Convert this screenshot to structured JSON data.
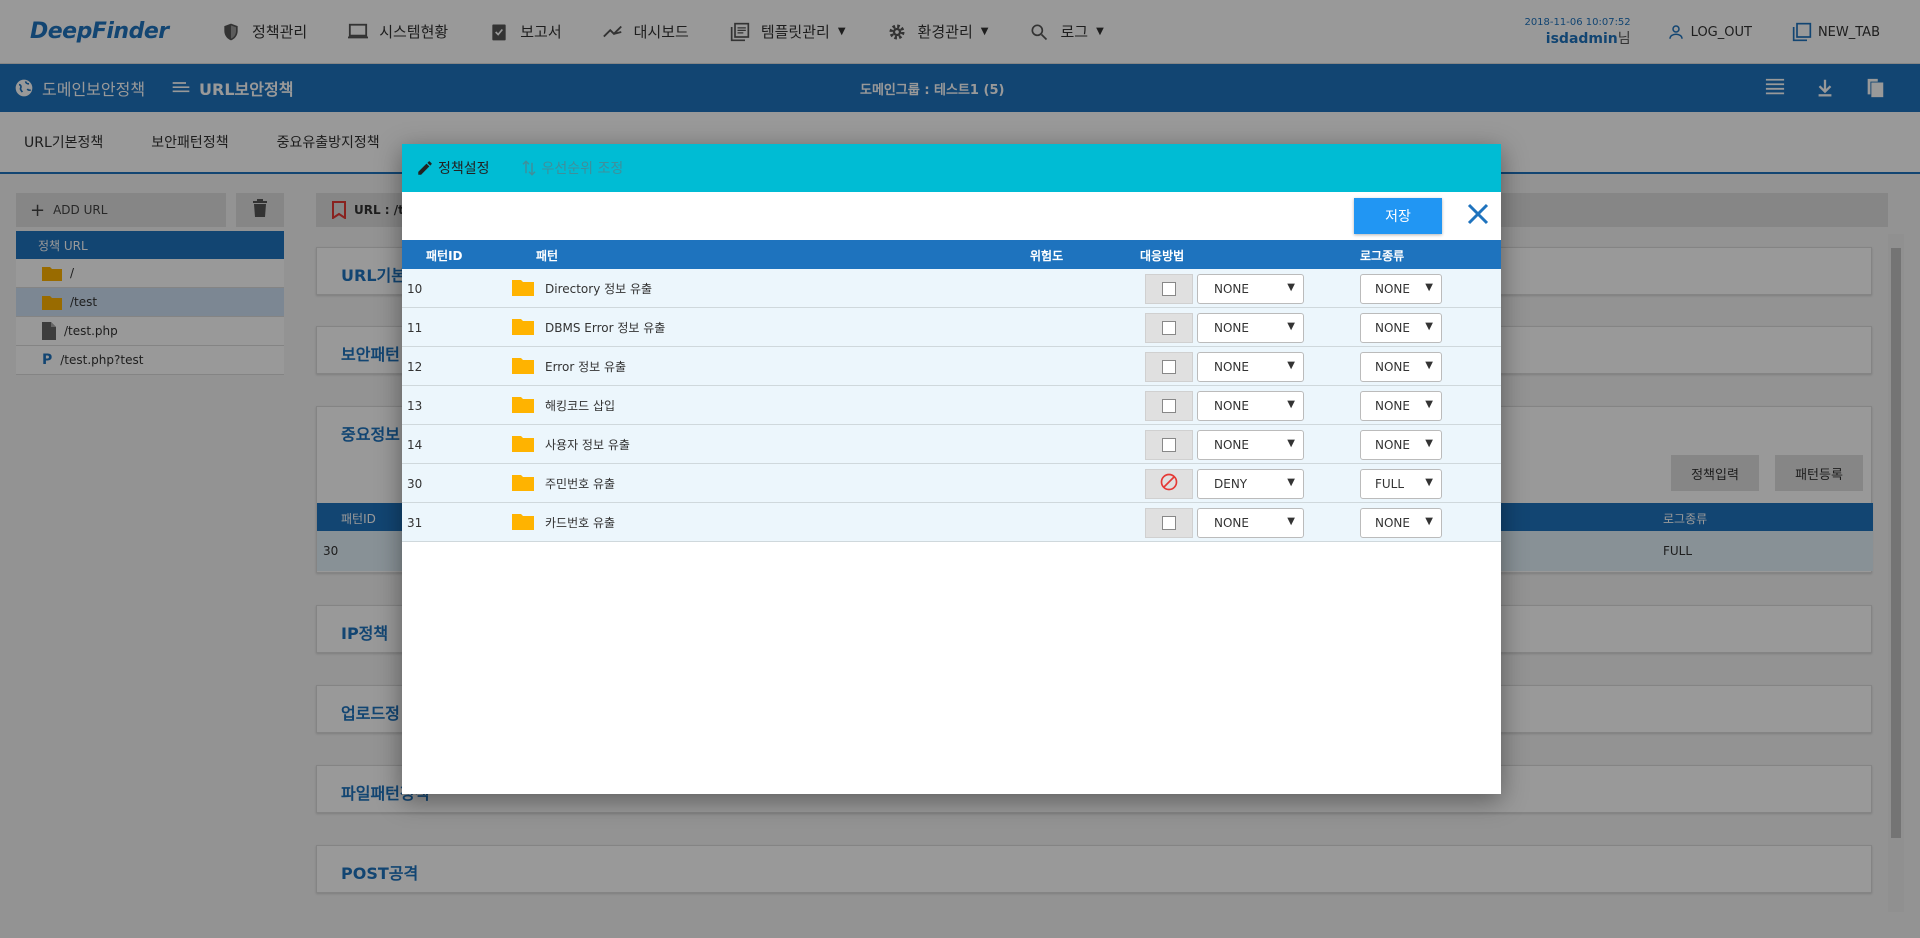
{
  "app": {
    "logo": "DeepFinder"
  },
  "nav": {
    "items": [
      {
        "label": "정책관리",
        "icon": "shield-icon",
        "caret": false
      },
      {
        "label": "시스템현황",
        "icon": "monitor-icon",
        "caret": false
      },
      {
        "label": "보고서",
        "icon": "clipboard-check-icon",
        "caret": false
      },
      {
        "label": "대시보드",
        "icon": "trending-icon",
        "caret": false
      },
      {
        "label": "템플릿관리",
        "icon": "library-icon",
        "caret": true
      },
      {
        "label": "환경관리",
        "icon": "gear-icon",
        "caret": true
      },
      {
        "label": "로그",
        "icon": "search-icon",
        "caret": true
      }
    ],
    "timestamp": "2018-11-06 10:07:52",
    "username": "isdadmin",
    "username_suffix": "님",
    "logout": "LOG_OUT",
    "newtab": "NEW_TAB"
  },
  "secbar": {
    "crumb1": "도메인보안정책",
    "crumb2": "URL보안정책",
    "domain_group": "도메인그룹 : 테스트1 (5)"
  },
  "subtabs": [
    "URL기본정책",
    "보안패턴정책",
    "중요유출방지정책"
  ],
  "left": {
    "add_url": "ADD URL",
    "tree_header": "정책 URL",
    "tree_items": [
      {
        "label": "/",
        "icon": "folder-icon"
      },
      {
        "label": "/test",
        "icon": "folder-icon"
      },
      {
        "label": "/test.php",
        "icon": "file-icon"
      },
      {
        "label": "/test.php?test",
        "icon": "p-icon"
      }
    ]
  },
  "main": {
    "url_label": "URL : /te",
    "panels": [
      "URL기본",
      "보안패턴",
      "중요정보",
      "IP정책",
      "업로드정",
      "파일패턴정책",
      "POST공격"
    ],
    "buttons": {
      "policy_input": "정책입력",
      "pattern_register": "패턴등록"
    },
    "table_head": {
      "id": "패턴ID",
      "log": "로그종류"
    },
    "table_row": {
      "id": "30",
      "log": "FULL"
    }
  },
  "modal": {
    "tabs": [
      {
        "label": "정책설정",
        "icon": "pencil-icon"
      },
      {
        "label": "우선순위 조정",
        "icon": "sort-arrows-icon"
      }
    ],
    "save": "저장",
    "headers": {
      "id": "패턴ID",
      "pattern": "패턴",
      "risk": "위험도",
      "action": "대응방법",
      "log": "로그종류"
    },
    "rows": [
      {
        "id": "10",
        "name": "Directory 정보 유출",
        "action": "NONE",
        "log": "NONE",
        "deny": false
      },
      {
        "id": "11",
        "name": "DBMS Error 정보 유출",
        "action": "NONE",
        "log": "NONE",
        "deny": false
      },
      {
        "id": "12",
        "name": "Error 정보 유출",
        "action": "NONE",
        "log": "NONE",
        "deny": false
      },
      {
        "id": "13",
        "name": "해킹코드 삽입",
        "action": "NONE",
        "log": "NONE",
        "deny": false
      },
      {
        "id": "14",
        "name": "사용자 정보 유출",
        "action": "NONE",
        "log": "NONE",
        "deny": false
      },
      {
        "id": "30",
        "name": "주민번호 유출",
        "action": "DENY",
        "log": "FULL",
        "deny": true
      },
      {
        "id": "31",
        "name": "카드번호 유출",
        "action": "NONE",
        "log": "NONE",
        "deny": false
      }
    ]
  },
  "colors": {
    "primary": "#1e73be",
    "modal_tab": "#00bcd4",
    "save": "#2196f3",
    "folder": "#ffb300",
    "deny": "#e53935"
  }
}
